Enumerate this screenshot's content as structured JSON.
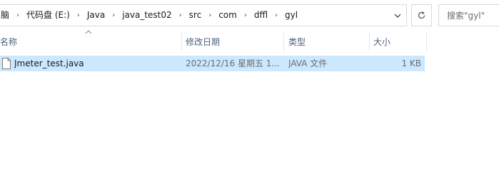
{
  "breadcrumb": [
    "脑",
    "代码盘 (E:)",
    "Java",
    "java_test02",
    "src",
    "com",
    "dffl",
    "gyl"
  ],
  "search": {
    "placeholder": "搜索\"gyl\""
  },
  "columns": {
    "name": "名称",
    "modified": "修改日期",
    "type": "类型",
    "size": "大小"
  },
  "files": [
    {
      "name": "Jmeter_test.java",
      "modified": "2022/12/16 星期五 1...",
      "type": "JAVA 文件",
      "size": "1 KB"
    }
  ],
  "icons": {
    "breadcrumb_separator": "chevron-right-icon",
    "address_dropdown": "chevron-down-icon",
    "refresh": "refresh-icon",
    "sort": "sort-ascending-icon",
    "file": "java-file-icon"
  },
  "colors": {
    "selection": "#cce8ff",
    "header_text": "#4c607a",
    "border": "#d9d9d9"
  }
}
